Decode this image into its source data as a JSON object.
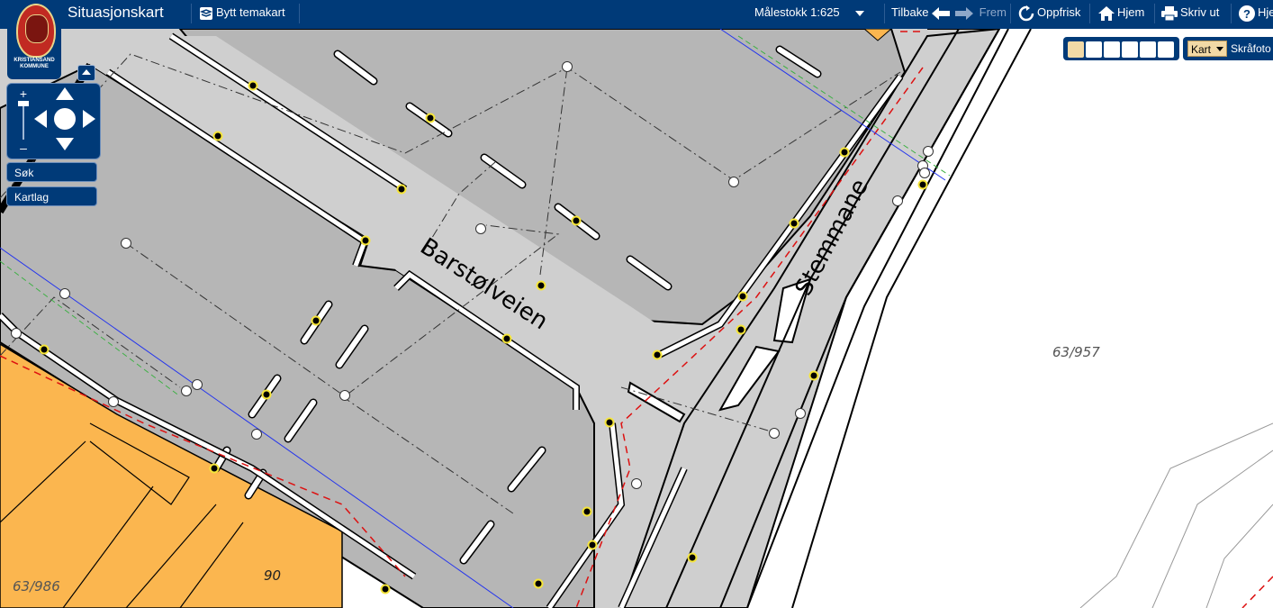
{
  "app": {
    "title": "Situasjonskart",
    "logo_text_line1": "KRISTIANSAND",
    "logo_text_line2": "KOMMUNE"
  },
  "toolbar": {
    "change_theme_label": "Bytt temakart",
    "scale_label": "Målestokk 1:625",
    "back_label": "Tilbake",
    "forward_label": "Frem",
    "refresh_label": "Oppfrisk",
    "home_label": "Hjem",
    "print_label": "Skriv ut",
    "help_label": "Hje"
  },
  "sidebar": {
    "search_label": "Søk",
    "layers_label": "Kartlag",
    "zoom_in": "+",
    "zoom_out": "–"
  },
  "map_tools": {
    "basemap_selected": "Kart",
    "basemap_alt": "Skråfoto",
    "tool_icons": [
      "pan-hand-icon",
      "zoom-magnifier-icon",
      "draw-pencil-icon",
      "identify-info-icon",
      "measure-ruler-icon",
      "clear-eraser-icon"
    ]
  },
  "map_labels": {
    "street_1": "Barstølveien",
    "street_2": "Stemmane",
    "parcel_1": "63/957",
    "parcel_2": "63/986",
    "house_number": "90"
  },
  "colors": {
    "header": "#003a78",
    "building": "#fbb64f",
    "parking_lot": "#b4b4b4",
    "road": "#cfcfcf",
    "accent_active": "#f2d9a6"
  }
}
